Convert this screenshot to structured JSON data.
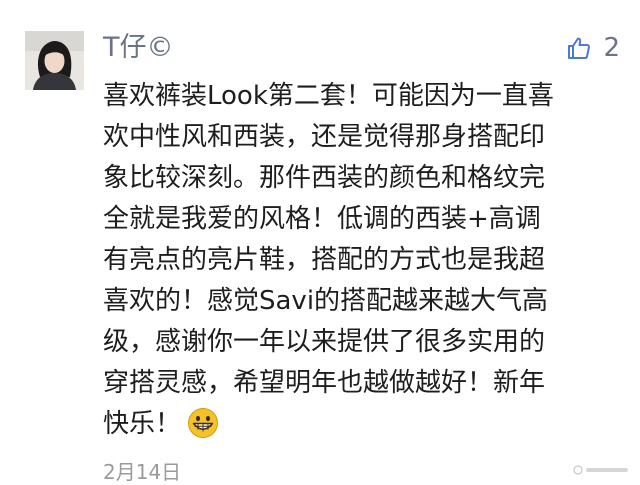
{
  "comment": {
    "user": {
      "name": "T仔©"
    },
    "likes": {
      "count": "2",
      "icon": "thumbs-up-icon"
    },
    "body_lines": [
      "喜欢裤装Look第二套！可能因为一直喜",
      "欢中性风和西装，还是觉得那身搭配印",
      "象比较深刻。那件西装的颜色和格纹完",
      "全就是我爱的风格！低调的西装+高调",
      "有亮点的亮片鞋，搭配的方式也是我超",
      "喜欢的！感觉Savi的搭配越来越大气高",
      "级，感谢你一年以来提供了很多实用的",
      "穿搭灵感，希望明年也越做越好！新年",
      "快乐！"
    ],
    "emoji": "grinning-face-emoji",
    "timestamp": "2月14日"
  },
  "colors": {
    "username": "#6b7486",
    "body_text": "#1e1e1e",
    "timestamp": "#9a9a9a",
    "emoji_face": "#f5c22c"
  }
}
